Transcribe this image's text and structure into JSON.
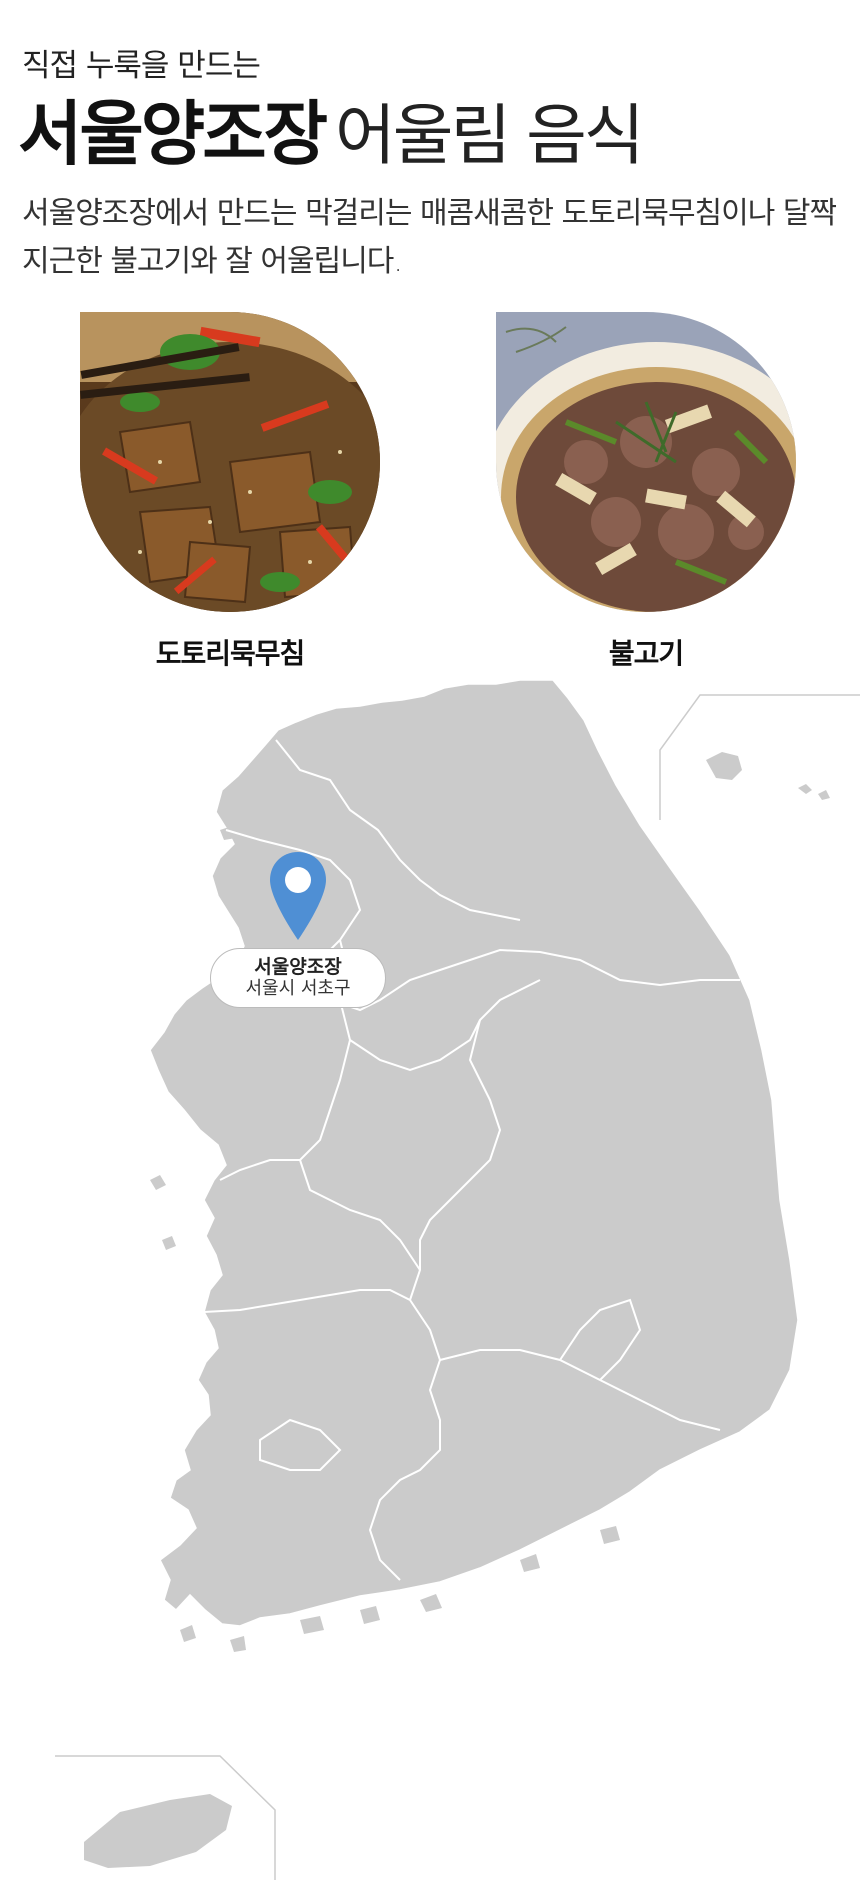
{
  "header": {
    "subtitle": "직접 누룩을 만드는",
    "title_bold": "서울양조장",
    "title_light": "어울림 음식"
  },
  "description": "서울양조장에서 만드는 막걸리는 매콤새콤한 도토리묵무침이나 달짝지근한 불고기와 잘 어울립니다.",
  "foods": [
    {
      "label": "도토리묵무침",
      "icon": "acorn-jelly-salad-photo"
    },
    {
      "label": "불고기",
      "icon": "bulgogi-photo"
    }
  ],
  "map": {
    "marker": {
      "name": "서울양조장",
      "address": "서울시 서초구",
      "color": "#4f8fd4"
    },
    "land_color": "#cbcbcb",
    "border_color": "#ffffff"
  }
}
